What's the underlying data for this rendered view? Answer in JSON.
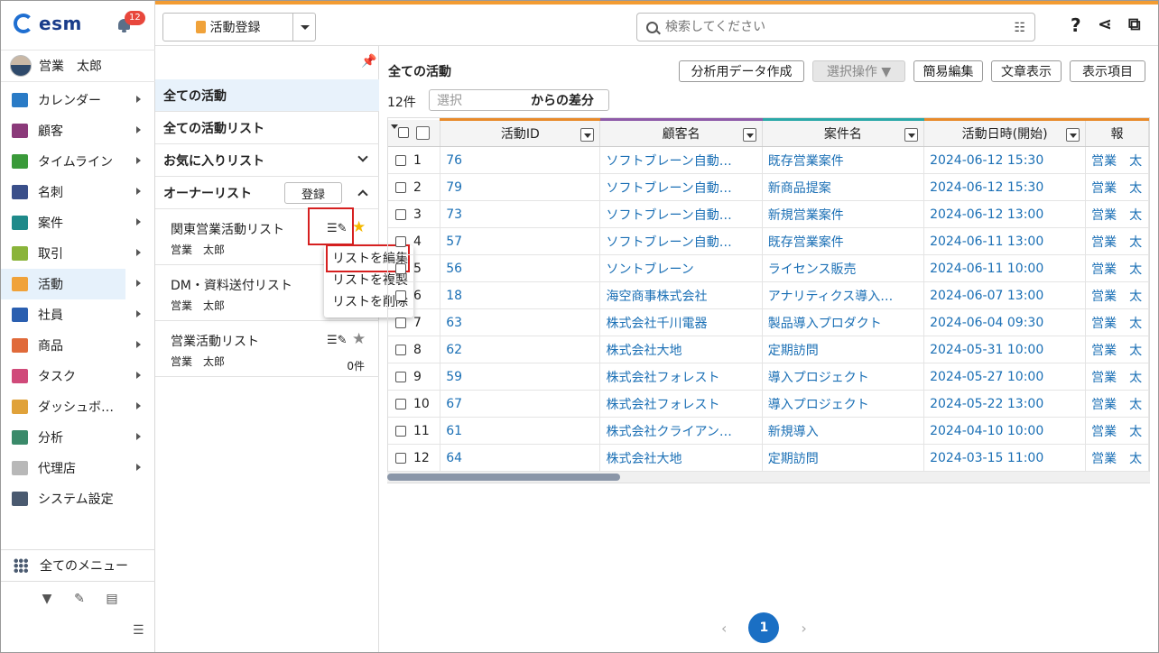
{
  "header": {
    "logo_text": "esm",
    "notification_count": "12",
    "activity_register_label": "活動登録",
    "search_placeholder": "検索してください"
  },
  "user": {
    "name": "営業　太郎"
  },
  "sidebar": {
    "items": [
      {
        "label": "カレンダー",
        "icon": "calendar-icon",
        "color": "#2a7bc6"
      },
      {
        "label": "顧客",
        "icon": "building-icon",
        "color": "#8b3a7a"
      },
      {
        "label": "タイムライン",
        "icon": "chat-icon",
        "color": "#3a9a3a"
      },
      {
        "label": "名刺",
        "icon": "card-icon",
        "color": "#3a4f8a"
      },
      {
        "label": "案件",
        "icon": "folder-icon",
        "color": "#1f8a8a"
      },
      {
        "label": "取引",
        "icon": "deal-icon",
        "color": "#8ab43a"
      },
      {
        "label": "活動",
        "icon": "clipboard-icon",
        "color": "#f0a23a"
      },
      {
        "label": "社員",
        "icon": "person-icon",
        "color": "#2a5fb0"
      },
      {
        "label": "商品",
        "icon": "product-icon",
        "color": "#e06a3a"
      },
      {
        "label": "タスク",
        "icon": "task-icon",
        "color": "#d04a7a"
      },
      {
        "label": "ダッシュボ…",
        "icon": "dashboard-icon",
        "color": "#e0a23a"
      },
      {
        "label": "分析",
        "icon": "chart-icon",
        "color": "#3a8a6a"
      },
      {
        "label": "代理店",
        "icon": "agency-icon",
        "color": "#b8b8b8"
      },
      {
        "label": "システム設定",
        "icon": "gear-icon",
        "color": "#4a5a70"
      }
    ],
    "all_menu_label": "全てのメニュー"
  },
  "list_panel": {
    "all_activities": "全ての活動",
    "all_activity_lists": "全ての活動リスト",
    "favorites": "お気に入りリスト",
    "owner_lists": "オーナーリスト",
    "register_label": "登録",
    "lists": [
      {
        "name": "関東営業活動リスト",
        "owner": "営業　太郎",
        "count": ""
      },
      {
        "name": "DM・資料送付リスト",
        "owner": "営業　太郎",
        "count": ""
      },
      {
        "name": "営業活動リスト",
        "owner": "営業　太郎",
        "count": "0件"
      }
    ],
    "context_menu": [
      "リストを編集",
      "リストを複製",
      "リストを削除"
    ]
  },
  "main": {
    "title": "全ての活動",
    "buttons": {
      "analysis": "分析用データ作成",
      "selection": "選択操作 ▼",
      "simple_edit": "簡易編集",
      "text_view": "文章表示",
      "display_items": "表示項目"
    },
    "count": "12件",
    "diff_placeholder": "選択",
    "diff_label": "からの差分",
    "columns": [
      "活動ID",
      "顧客名",
      "案件名",
      "活動日時(開始)",
      "報"
    ],
    "column_colors": [
      "#e88a2a",
      "#8e5aa8",
      "#2aa8a8",
      "#e88a2a",
      "#e88a2a"
    ],
    "rows": [
      {
        "n": "1",
        "id": "76",
        "customer": "ソフトブレーン自動…",
        "deal": "既存営業案件",
        "date": "2024-06-12 15:30",
        "rep": "営業　太"
      },
      {
        "n": "2",
        "id": "79",
        "customer": "ソフトブレーン自動…",
        "deal": "新商品提案",
        "date": "2024-06-12 15:30",
        "rep": "営業　太"
      },
      {
        "n": "3",
        "id": "73",
        "customer": "ソフトブレーン自動…",
        "deal": "新規営業案件",
        "date": "2024-06-12 13:00",
        "rep": "営業　太"
      },
      {
        "n": "4",
        "id": "57",
        "customer": "ソフトブレーン自動…",
        "deal": "既存営業案件",
        "date": "2024-06-11 13:00",
        "rep": "営業　太"
      },
      {
        "n": "5",
        "id": "56",
        "customer": "ソントブレーン",
        "deal": "ライセンス販売",
        "date": "2024-06-11 10:00",
        "rep": "営業　太"
      },
      {
        "n": "6",
        "id": "18",
        "customer": "海空商事株式会社",
        "deal": "アナリティクス導入…",
        "date": "2024-06-07 13:00",
        "rep": "営業　太"
      },
      {
        "n": "7",
        "id": "63",
        "customer": "株式会社千川電器",
        "deal": "製品導入プロダクト",
        "date": "2024-06-04 09:30",
        "rep": "営業　太"
      },
      {
        "n": "8",
        "id": "62",
        "customer": "株式会社大地",
        "deal": "定期訪問",
        "date": "2024-05-31 10:00",
        "rep": "営業　太"
      },
      {
        "n": "9",
        "id": "59",
        "customer": "株式会社フォレスト",
        "deal": "導入プロジェクト",
        "date": "2024-05-27 10:00",
        "rep": "営業　太"
      },
      {
        "n": "10",
        "id": "67",
        "customer": "株式会社フォレスト",
        "deal": "導入プロジェクト",
        "date": "2024-05-22 13:00",
        "rep": "営業　太"
      },
      {
        "n": "11",
        "id": "61",
        "customer": "株式会社クライアン…",
        "deal": "新規導入",
        "date": "2024-04-10 10:00",
        "rep": "営業　太"
      },
      {
        "n": "12",
        "id": "64",
        "customer": "株式会社大地",
        "deal": "定期訪問",
        "date": "2024-03-15 11:00",
        "rep": "営業　太"
      }
    ],
    "current_page": "1"
  }
}
